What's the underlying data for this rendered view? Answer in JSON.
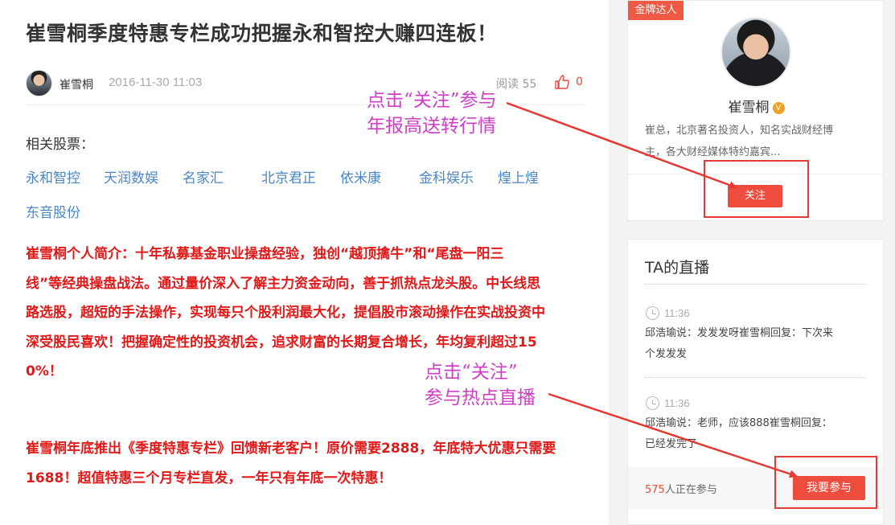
{
  "article": {
    "title": "崔雪桐季度特惠专栏成功把握永和智控大赚四连板！",
    "author": "崔雪桐",
    "date": "2016-11-30 11:03",
    "reads": "阅读 55",
    "likes": "0",
    "related_label": "相关股票：",
    "stocks": [
      "永和智控",
      "天润数娱",
      "名家汇",
      "北京君正",
      "依米康",
      "金科娱乐",
      "煌上煌",
      "东音股份"
    ],
    "intro_lines": [
      "崔雪桐个人简介：十年私募基金职业操盘经验，独创“越顶擒牛”和“尾盘一阳三",
      "线”等经典操盘战法。通过量价深入了解主力资金动向，善于抓热点龙头股。中长线思",
      "路选股，超短的手法操作，实现每只个股利润最大化，提倡股市滚动操作在实战投资中",
      "深受股民喜欢！把握确定性的投资机会，追求财富的长期复合增长，年均复利超过15",
      "0%！"
    ],
    "promo_lines": [
      "崔雪桐年底推出《季度特惠专栏》回馈新老客户！原价需要2888，年底特大优惠只需要",
      "1688！超值特惠三个月专栏直发，一年只有年底一次特惠！"
    ]
  },
  "profile": {
    "badge": "金牌达人",
    "name": "崔雪桐",
    "verified_mark": "V",
    "desc_lines": [
      "崔总，北京著名投资人，知名实战财经博",
      "主，各大财经媒体特约嘉宾..."
    ],
    "follow_label": "关注"
  },
  "live": {
    "title": "TA的直播",
    "items": [
      {
        "time": "11:36",
        "text_lines": [
          "邱浩瑜说：发发发呀崔雪桐回复：下次来",
          "个发发发"
        ]
      },
      {
        "time": "11:36",
        "text_lines": [
          "邱浩瑜说：老师，应该888崔雪桐回复：",
          "已经发完了"
        ]
      }
    ],
    "participants_count": "575",
    "participants_suffix": "人正在参与",
    "join_label": "我要参与"
  },
  "annotations": {
    "follow_hint": [
      "点击“关注”参与",
      "年报高送转行情"
    ],
    "live_hint": [
      "点击“关注”",
      "参与热点直播"
    ]
  },
  "colors": {
    "accent_red": "#ee4c3c",
    "body_red": "#e11919",
    "link_blue": "#4a86c5",
    "annotation_magenta": "#cf3fc6"
  },
  "icons": [
    "thumbs-up-icon",
    "clock-icon",
    "verified-icon"
  ]
}
